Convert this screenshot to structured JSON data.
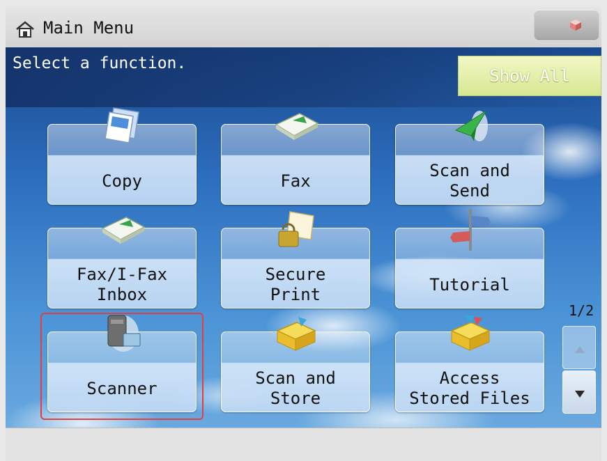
{
  "header": {
    "title": "Main Menu",
    "home_icon": "home-icon",
    "corner_icon": "status-cube-icon"
  },
  "main": {
    "instruction": "Select a function.",
    "show_all_label": "Show All",
    "page_indicator": "1/2",
    "scroll_up_icon": "triangle-up-icon",
    "scroll_down_icon": "triangle-down-icon",
    "selected_function": "Scanner",
    "functions": [
      {
        "label": "Copy",
        "icon": "copy-icon"
      },
      {
        "label": "Fax",
        "icon": "fax-icon"
      },
      {
        "label": "Scan and\nSend",
        "icon": "scan-send-icon"
      },
      {
        "label": "Fax/I-Fax\nInbox",
        "icon": "fax-inbox-icon"
      },
      {
        "label": "Secure\nPrint",
        "icon": "secure-print-icon"
      },
      {
        "label": "Tutorial",
        "icon": "tutorial-icon"
      },
      {
        "label": "Scanner",
        "icon": "scanner-icon"
      },
      {
        "label": "Scan and\nStore",
        "icon": "scan-store-icon"
      },
      {
        "label": "Access\nStored Files",
        "icon": "stored-files-icon"
      }
    ]
  },
  "colors": {
    "accent_show_all": "#d7e893",
    "selection_outline": "#e04040",
    "sky_top": "#1a4a8e",
    "sky_bottom": "#6aa9df"
  }
}
